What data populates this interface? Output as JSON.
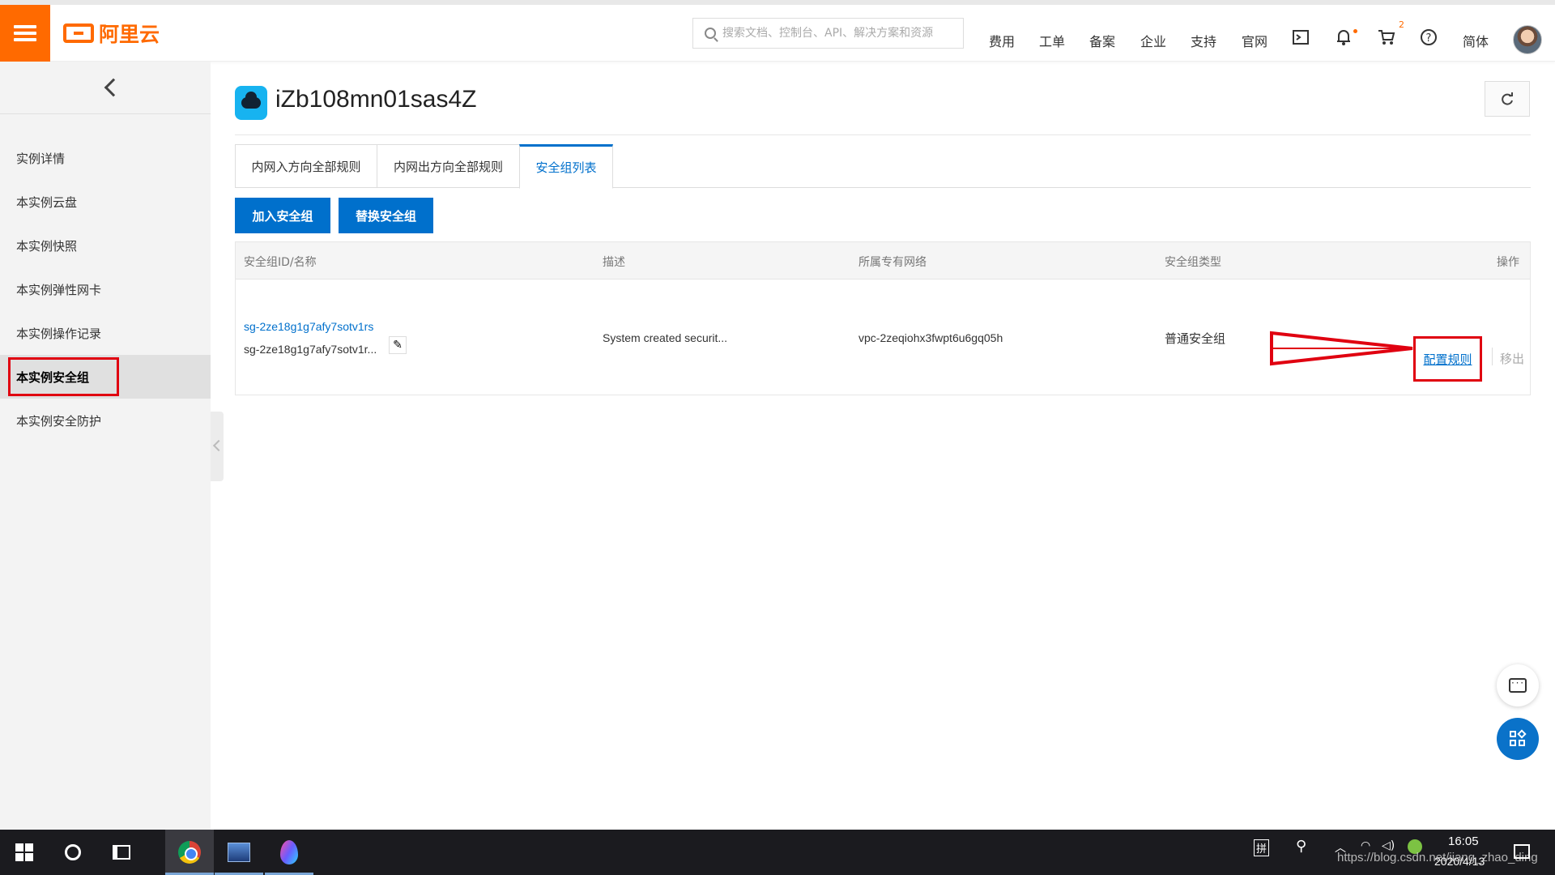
{
  "header": {
    "logo_text": "阿里云",
    "search_placeholder": "搜索文档、控制台、API、解决方案和资源",
    "nav": [
      "费用",
      "工单",
      "备案",
      "企业",
      "支持",
      "官网"
    ],
    "cart_count": "2",
    "language": "简体",
    "icons": [
      "terminal-icon",
      "bell-icon",
      "cart-icon",
      "help-icon"
    ]
  },
  "sidebar": {
    "items": [
      {
        "label": "实例详情"
      },
      {
        "label": "本实例云盘"
      },
      {
        "label": "本实例快照"
      },
      {
        "label": "本实例弹性网卡"
      },
      {
        "label": "本实例操作记录"
      },
      {
        "label": "本实例安全组",
        "active": true
      },
      {
        "label": "本实例安全防护"
      }
    ]
  },
  "main": {
    "title": "iZb108mn01sas4Z",
    "tabs": [
      {
        "label": "内网入方向全部规则"
      },
      {
        "label": "内网出方向全部规则"
      },
      {
        "label": "安全组列表",
        "active": true
      }
    ],
    "buttons": {
      "join": "加入安全组",
      "replace": "替换安全组"
    },
    "table": {
      "headers": [
        "安全组ID/名称",
        "描述",
        "所属专有网络",
        "安全组类型",
        "操作"
      ],
      "rows": [
        {
          "id": "sg-2ze18g1g7afy7sotv1rs",
          "name": "sg-2ze18g1g7afy7sotv1r...",
          "description": "System created securit...",
          "vpc": "vpc-2zeqiohx3fwpt6u6gq05h",
          "type": "普通安全组",
          "action_config": "配置规则",
          "action_remove": "移出"
        }
      ]
    }
  },
  "taskbar": {
    "time": "16:05",
    "date": "2020/4/13",
    "tray_ime": "拼",
    "watermark": "https://blog.csdn.net/jiang_zhao_ding"
  },
  "colors": {
    "brand": "#ff6a00",
    "primary": "#0070cc",
    "highlight": "#e00010"
  }
}
